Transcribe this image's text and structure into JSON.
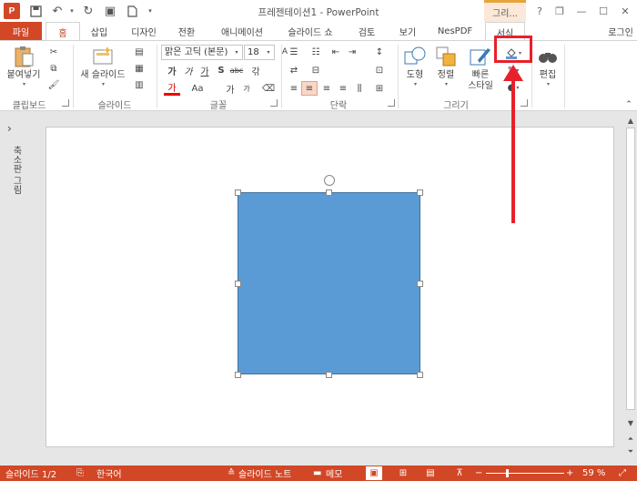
{
  "app": {
    "logo": "P",
    "title": "프레젠테이션1 - PowerPoint",
    "contextual_tab_group": "그리..."
  },
  "window_controls": {
    "help": "?",
    "restore": "❐",
    "minimize": "—",
    "maximize": "☐",
    "close": "✕"
  },
  "tabs": {
    "file": "파일",
    "home": "홈",
    "insert": "삽입",
    "design": "디자인",
    "transitions": "전환",
    "animations": "애니메이션",
    "slideshow": "슬라이드 쇼",
    "review": "검토",
    "view": "보기",
    "nespdf": "NesPDF",
    "format": "서식",
    "signin": "로그인"
  },
  "ribbon": {
    "clipboard": {
      "paste": "붙여넣기",
      "label": "클립보드"
    },
    "slides": {
      "new_slide_line1": "새 슬라이드",
      "label": "슬라이드"
    },
    "font": {
      "font_name": "맑은 고딕 (본문)",
      "font_size": "18",
      "label": "글꼴",
      "bold": "가",
      "italic": "가",
      "underline": "가",
      "shadow": "S",
      "strike": "abc",
      "spacing": "갂",
      "color": "가",
      "case": "Aa",
      "grow": "가",
      "shrink": "가"
    },
    "paragraph": {
      "label": "단락"
    },
    "drawing": {
      "shapes": "도형",
      "arrange": "정렬",
      "quick_styles_1": "빠른",
      "quick_styles_2": "스타일",
      "label": "그리기"
    },
    "editing": {
      "label": "편집"
    }
  },
  "left_pane": {
    "label": "축소판 그림"
  },
  "status": {
    "slide_counter": "슬라이드 1/2",
    "language": "한국어",
    "notes": "슬라이드 노트",
    "comments": "메모",
    "zoom": "59 %"
  },
  "colors": {
    "accent": "#d24726",
    "shape_fill": "#5b9bd5",
    "annotation": "#e8202a"
  }
}
